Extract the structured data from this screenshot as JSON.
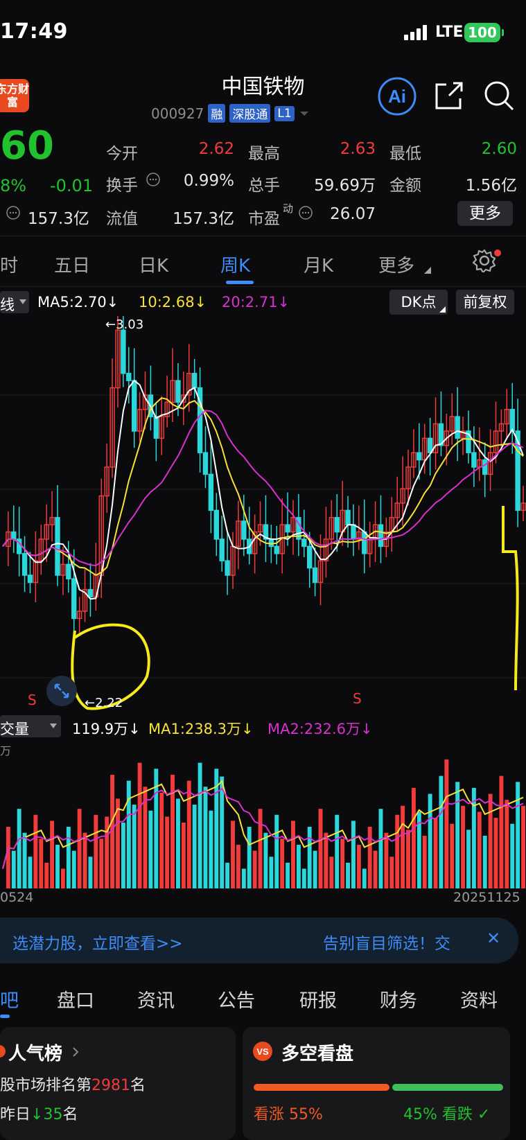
{
  "status": {
    "time": "17:49",
    "network": "LTE",
    "battery": "100"
  },
  "header": {
    "logo_text": "东方财富",
    "stock_name": "中国铁物",
    "code": "000927",
    "tags": [
      "融",
      "深股通",
      "L1"
    ],
    "icons": [
      "ai-icon",
      "share-icon",
      "search-icon"
    ]
  },
  "quote": {
    "price": "60",
    "pct": "8%",
    "change": "-0.01",
    "mcap_value": "157.3亿",
    "open_label": "今开",
    "open": "2.62",
    "high_label": "最高",
    "high": "2.63",
    "low_label": "最低",
    "low": "2.60",
    "turnover_label": "换手",
    "turnover": "0.99%",
    "vol_label": "总手",
    "vol": "59.69万",
    "amount_label": "金额",
    "amount": "1.56亿",
    "float_label": "流值",
    "float": "157.3亿",
    "pe_label": "市盈",
    "pe_sup": "动",
    "pe": "26.07",
    "more": "更多"
  },
  "tabs": {
    "items": [
      "时",
      "五日",
      "日K",
      "周K",
      "月K",
      "更多"
    ],
    "active": "周K"
  },
  "chart_legend": {
    "line_sel": "线",
    "ma5": "MA5:2.70↓",
    "ma10": "10:2.68↓",
    "ma20": "20:2.71↓",
    "dk": "DK点",
    "fq": "前复权",
    "high_mark": "←3.03",
    "low_mark": "←2.22",
    "s1": "S",
    "s2": "S"
  },
  "volume_legend": {
    "selector": "交量",
    "vol": "119.9万↓",
    "ma1": "MA1:238.3万↓",
    "ma2": "MA2:232.6万↓",
    "unit": "万"
  },
  "dates": {
    "start": "0524",
    "end": "20251125"
  },
  "banner": {
    "left": "选潜力股，立即查看>>",
    "right": "告别盲目筛选！交",
    "close": "✕"
  },
  "bottom_tabs": {
    "items": [
      "吧",
      "盘口",
      "资讯",
      "公告",
      "研报",
      "财务",
      "资料"
    ],
    "active": "吧"
  },
  "cards": {
    "popular_title": "人气榜",
    "rank_prefix": "股市场排名第",
    "rank": "2981",
    "rank_suffix": "名",
    "yday_prefix": "昨日",
    "yday_value": "35",
    "yday_suffix": "名",
    "dk_title": "多空看盘",
    "bull_label": "看涨",
    "bull_pct": "55%",
    "bear_pct": "45%",
    "bear_label": "看跌"
  },
  "colors": {
    "up": "#f23b3b",
    "down": "#22c22e",
    "accent": "#3d8cf7",
    "ma5": "#ffffff",
    "ma10": "#f6e23a",
    "ma20": "#d930d0",
    "cyan": "#2ad7db"
  }
}
